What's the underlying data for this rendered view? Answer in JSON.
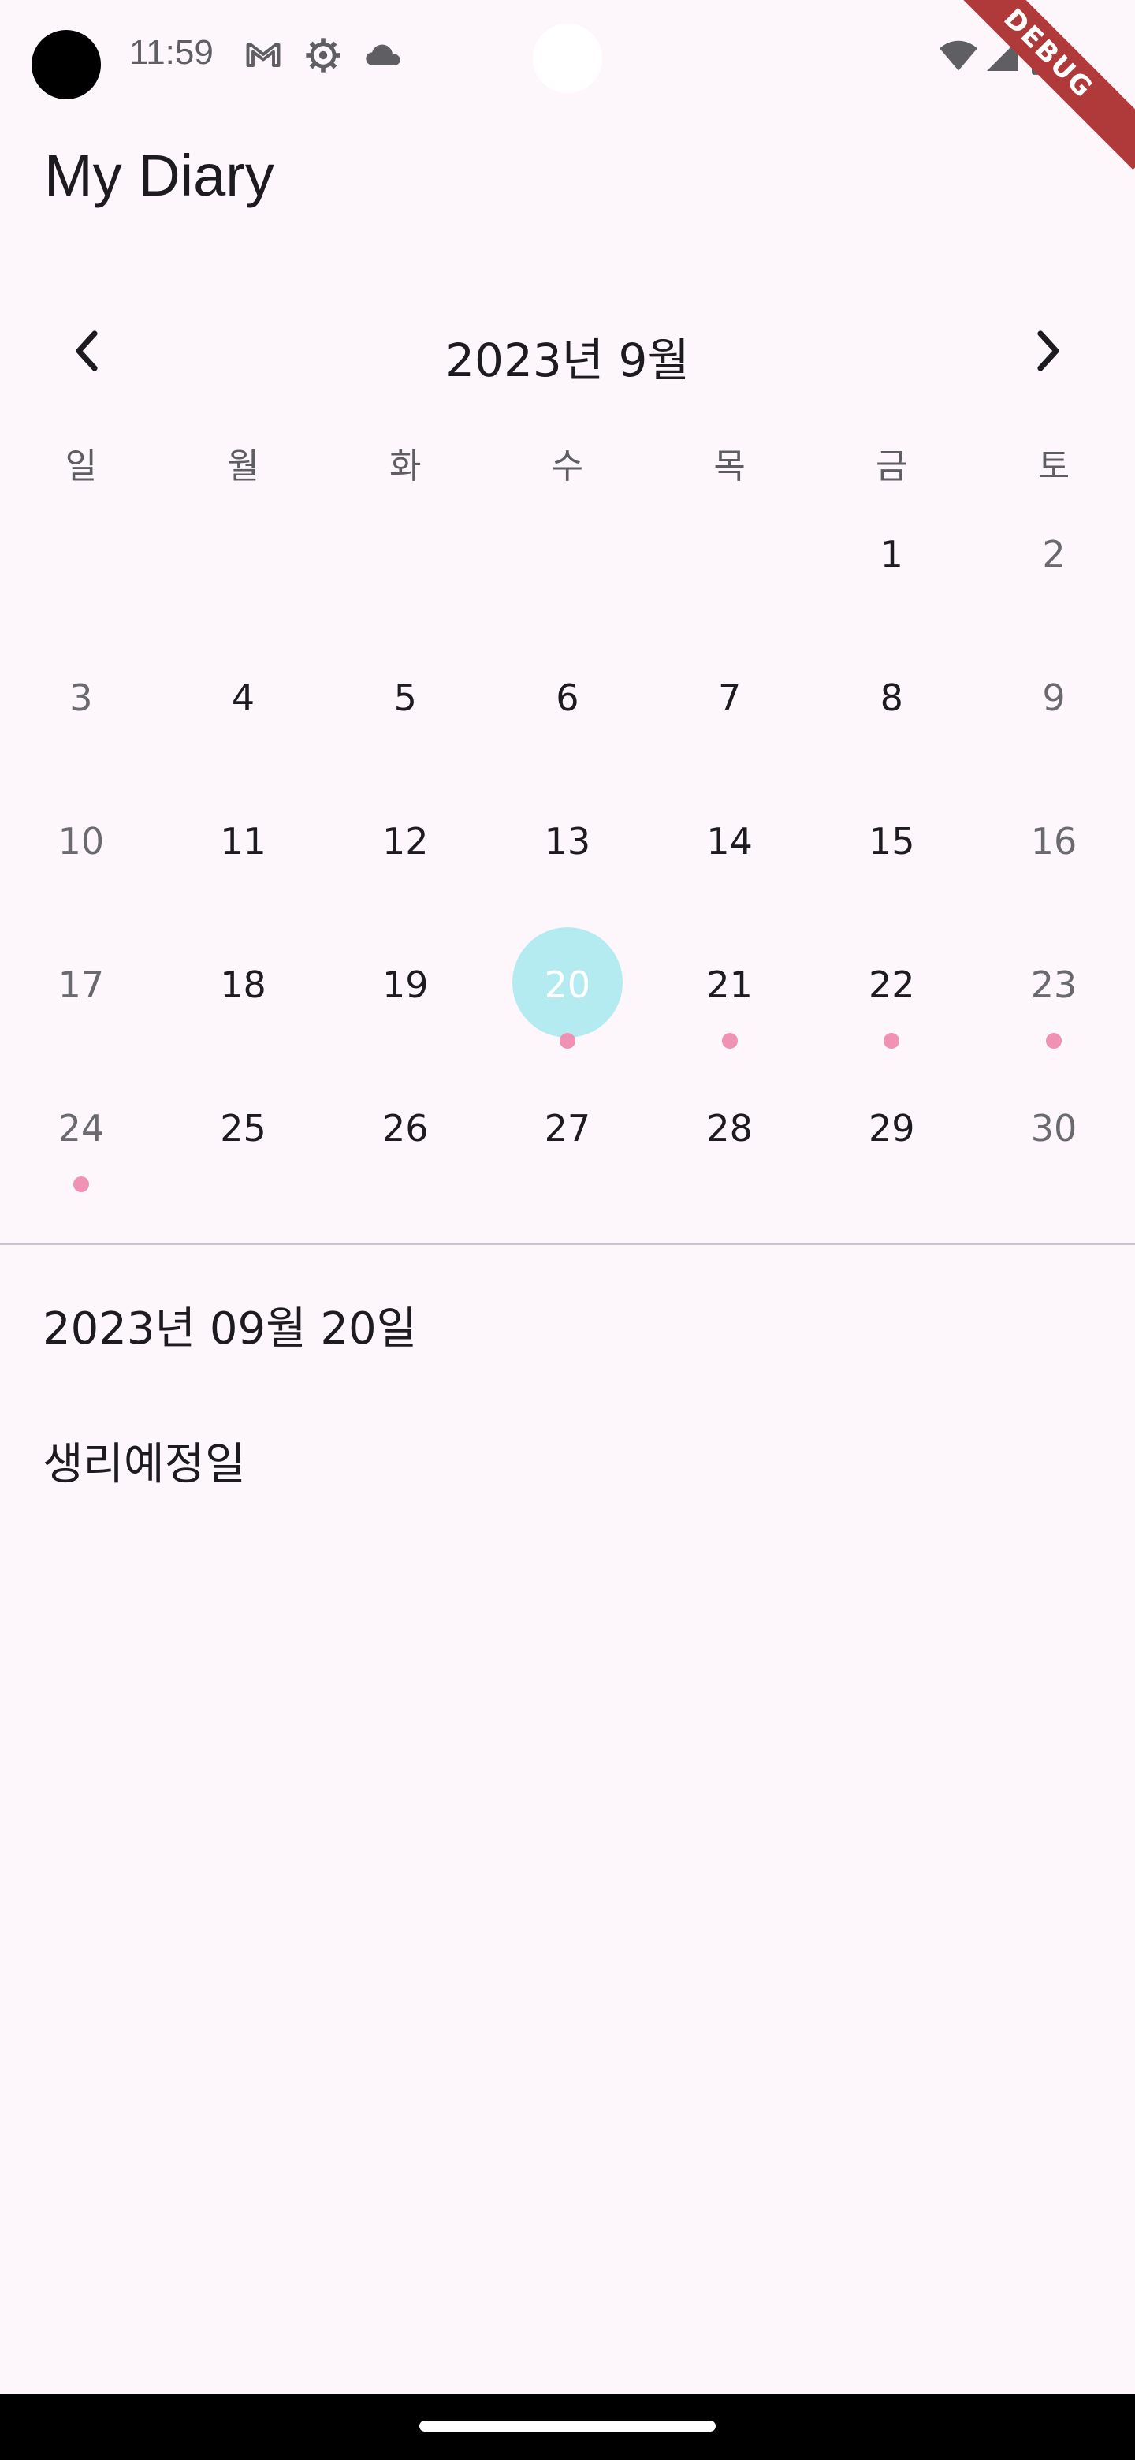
{
  "status_bar": {
    "time": "11:59",
    "icons": [
      "gmail-icon",
      "settings-gear-icon",
      "cloud-icon",
      "wifi-icon",
      "cell-signal-icon",
      "battery-icon"
    ],
    "debug_label": "DEBUG"
  },
  "app_bar": {
    "title": "My Diary"
  },
  "calendar": {
    "month_title": "2023년 9월",
    "weekdays": [
      "일",
      "월",
      "화",
      "수",
      "목",
      "금",
      "토"
    ],
    "leading_blank_days": 5,
    "days": [
      "1",
      "2",
      "3",
      "4",
      "5",
      "6",
      "7",
      "8",
      "9",
      "10",
      "11",
      "12",
      "13",
      "14",
      "15",
      "16",
      "17",
      "18",
      "19",
      "20",
      "21",
      "22",
      "23",
      "24",
      "25",
      "26",
      "27",
      "28",
      "29",
      "30"
    ],
    "selected_day": "20",
    "event_days": [
      "20",
      "21",
      "22",
      "23",
      "24"
    ],
    "colors": {
      "selected": "#b3ebf0",
      "event_dot": "#ef92b4"
    }
  },
  "detail": {
    "selected_date": "2023년 09월 20일",
    "events": [
      "생리예정일"
    ]
  }
}
